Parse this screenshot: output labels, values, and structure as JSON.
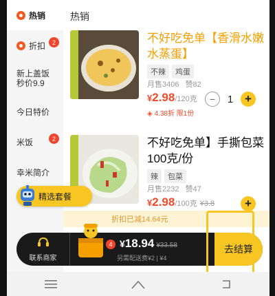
{
  "sidebar": {
    "items": [
      {
        "label": "热销",
        "active": true
      },
      {
        "label": "折扣",
        "badge": "2"
      },
      {
        "label": "新上盖饭\n秒价9.9"
      },
      {
        "label": "今日特价"
      },
      {
        "label": "米饭",
        "badge": "2"
      },
      {
        "label": "幸米简介"
      }
    ]
  },
  "section_title": "热销",
  "items": [
    {
      "name": "不好吃免单【香滑水嫩水蒸蛋】",
      "tags": [
        "不辣",
        "鸡蛋"
      ],
      "sales": "月售3406",
      "likes": "赞82",
      "currency": "¥",
      "price": "2.98",
      "unit": "/120克",
      "discount": "4.38折 限1份",
      "quantity": "1"
    },
    {
      "name": "不好吃免单】手撕包菜100克/份",
      "tags": [
        "辣",
        "包菜"
      ],
      "sales": "月售2232",
      "likes": "赞47",
      "currency": "¥",
      "price": "2.98",
      "unit": "/100克",
      "old_price": "¥3.8"
    }
  ],
  "combo_label": "精选套餐",
  "discount_strip": "折扣已减14.64元",
  "cart": {
    "contact_label": "联系商家",
    "badge": "4",
    "currency": "¥",
    "total": "18.94",
    "old_total": "¥33.58",
    "delivery": "另需配送费¥2 | ¥4",
    "checkout_label": "去结算"
  },
  "icons": [
    "fire-icon",
    "discount-icon",
    "robot-icon",
    "support-icon",
    "cart-icon",
    "menu-icon",
    "home-icon",
    "back-icon"
  ],
  "colors": {
    "accent": "#f7c623",
    "price": "#f04a2a",
    "highlight": "#f5a000"
  }
}
